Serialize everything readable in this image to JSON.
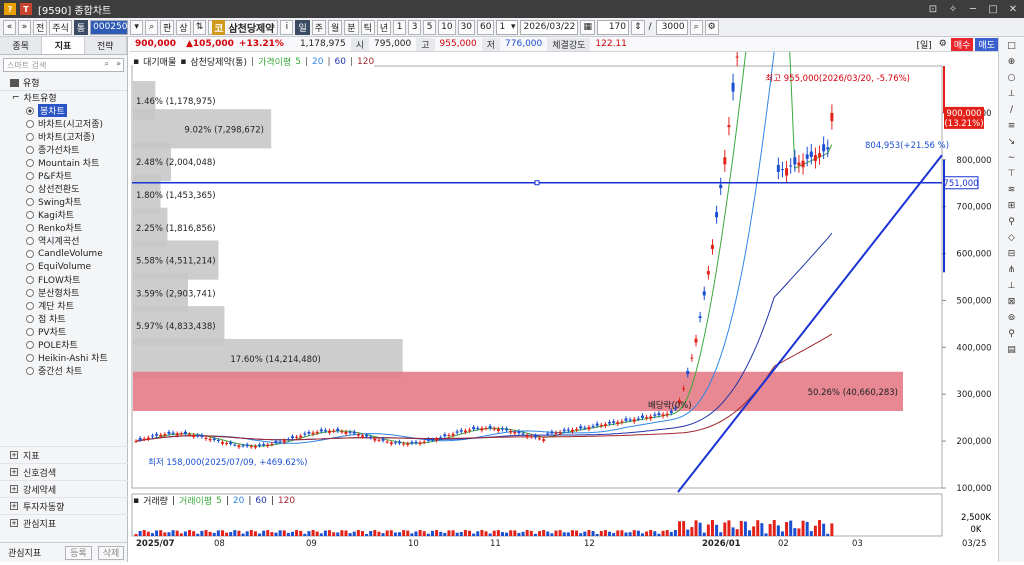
{
  "window": {
    "title": "[9590] 종합차트"
  },
  "toolbar": {
    "nav_prev": "«",
    "nav_next": "»",
    "btn_jeon": "전",
    "btn_stock": "주식",
    "btn_tong": "통",
    "code": "000250",
    "btn_pan": "판",
    "btn_sang": "상",
    "stock_name": "삼천당제약",
    "period_il": "일",
    "period_ju": "주",
    "period_wol": "월",
    "period_bun": "분",
    "period_tik": "틱",
    "period_nyeon": "년",
    "tick_1": "1",
    "tick_3": "3",
    "tick_5": "5",
    "tick_10": "10",
    "tick_30": "30",
    "tick_60": "60",
    "period_sel": "1",
    "date": "2026/03/22",
    "count": "170",
    "slash": "/",
    "max": "3000"
  },
  "left_panel": {
    "tabs": [
      "종목",
      "지표",
      "전략"
    ],
    "search_placeholder": "스마트 검색",
    "section": "유형",
    "group": "차트유형",
    "items": [
      "봉차트",
      "바차트(시고저종)",
      "바차트(고저종)",
      "종가선차트",
      "Mountain 차트",
      "P&F차트",
      "삼선전환도",
      "Swing차트",
      "Kagi차트",
      "Renko차트",
      "역시계곡선",
      "CandleVolume",
      "EquiVolume",
      "FLOW차트",
      "분산형차트",
      "계단 차트",
      "점 차트",
      "PV차트",
      "POLE차트",
      "Heikin-Ashi 차트",
      "중간선 차트"
    ],
    "selected_index": 0,
    "bottom": [
      "지표",
      "신호검색",
      "강세약세",
      "투자자동향",
      "관심지표"
    ],
    "footer_label": "관심지표",
    "footer_add": "등록",
    "footer_del": "삭제"
  },
  "infobar": {
    "price": "900,000",
    "change": "▲105,000",
    "pct": "+13.21%",
    "volume": "1,178,975",
    "open_label": "시",
    "open": "795,000",
    "high_label": "고",
    "high": "955,000",
    "low_label": "저",
    "low": "776,000",
    "strength_label": "체결강도",
    "strength": "122.11",
    "period_tag": "[일]",
    "buy": "매수",
    "sell": "매도"
  },
  "chart_legend": {
    "name": "대기매물",
    "stock": "삼천당제약(통)",
    "ma_label": "가격이평",
    "ma": [
      "5",
      "20",
      "60",
      "120"
    ]
  },
  "volume_legend": {
    "name": "거래량",
    "ma_label": "거래이평",
    "ma": [
      "5",
      "20",
      "60",
      "120"
    ]
  },
  "colors": {
    "up": "#e32119",
    "down": "#1a4fd1",
    "ma5": "#3aa83a",
    "ma20": "#2f86e6",
    "ma60": "#2233aa",
    "ma120": "#a0272e",
    "profile": "#c8c8c8",
    "profile_hl": "#e47b86",
    "trend": "#1a33d4"
  },
  "chart_data": {
    "type": "candlestick",
    "y_ticks": [
      "900,000",
      "800,000",
      "700,000",
      "600,000",
      "500,000",
      "400,000",
      "300,000",
      "200,000",
      "100,000"
    ],
    "y_range": [
      100000,
      1000000
    ],
    "x_labels": [
      "2025/07",
      "08",
      "09",
      "10",
      "11",
      "12",
      "2026/01",
      "02",
      "03",
      "03/25"
    ],
    "volume_ticks": [
      "2,500K",
      "0K"
    ],
    "current_price_label": "900,000",
    "current_pct_label": "(13.21%)",
    "hline_label": "751,000",
    "hline_value": 751000,
    "annotations": {
      "high": "최고 955,000(2026/03/20, -5.76%)",
      "low": "최저 158,000(2025/07/09, +469.62%)",
      "dividend": "배당락(0%)",
      "last_point": "804,953(+21.56 %)"
    },
    "volume_profile": [
      {
        "label": "1.46% (1,178,975)",
        "pct": 1.46,
        "price": 925000
      },
      {
        "label": "9.02% (7,298,672)",
        "pct": 9.02,
        "price": 865000
      },
      {
        "label": "2.48% (2,004,048)",
        "pct": 2.48,
        "price": 795000
      },
      {
        "label": "1.80% (1,453,365)",
        "pct": 1.8,
        "price": 725000
      },
      {
        "label": "2.25% (1,816,856)",
        "pct": 2.25,
        "price": 655000
      },
      {
        "label": "5.58% (4,511,214)",
        "pct": 5.58,
        "price": 585000
      },
      {
        "label": "3.59% (2,903,741)",
        "pct": 3.59,
        "price": 515000
      },
      {
        "label": "5.97% (4,833,438)",
        "pct": 5.97,
        "price": 445000
      },
      {
        "label": "17.60% (14,214,480)",
        "pct": 17.6,
        "price": 375000
      },
      {
        "label": "50.26% (40,660,283)",
        "pct": 50.26,
        "price": 305000,
        "highlight": true
      }
    ]
  },
  "right_tools": [
    "□",
    "⊕",
    "○",
    "⟂",
    "∕",
    "≡",
    "↘",
    "∼",
    "⊤",
    "≋",
    "⊞",
    "⚲",
    "◇",
    "⊟",
    "⋔",
    "⊥",
    "⊠",
    "⊚",
    "⚲",
    "▤"
  ]
}
